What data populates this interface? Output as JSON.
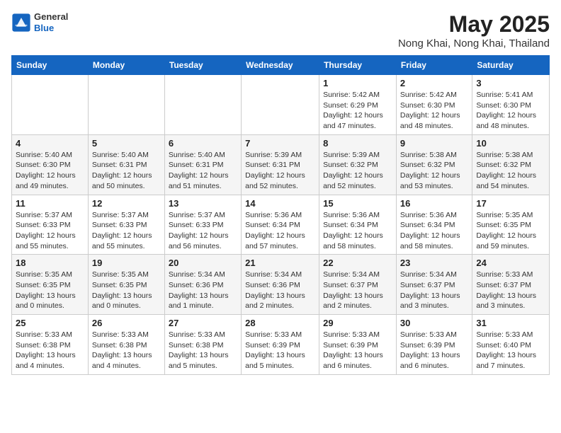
{
  "header": {
    "logo": {
      "general": "General",
      "blue": "Blue"
    },
    "title": "May 2025",
    "location": "Nong Khai, Nong Khai, Thailand"
  },
  "weekdays": [
    "Sunday",
    "Monday",
    "Tuesday",
    "Wednesday",
    "Thursday",
    "Friday",
    "Saturday"
  ],
  "weeks": [
    [
      {
        "day": "",
        "info": ""
      },
      {
        "day": "",
        "info": ""
      },
      {
        "day": "",
        "info": ""
      },
      {
        "day": "",
        "info": ""
      },
      {
        "day": "1",
        "info": "Sunrise: 5:42 AM\nSunset: 6:29 PM\nDaylight: 12 hours\nand 47 minutes."
      },
      {
        "day": "2",
        "info": "Sunrise: 5:42 AM\nSunset: 6:30 PM\nDaylight: 12 hours\nand 48 minutes."
      },
      {
        "day": "3",
        "info": "Sunrise: 5:41 AM\nSunset: 6:30 PM\nDaylight: 12 hours\nand 48 minutes."
      }
    ],
    [
      {
        "day": "4",
        "info": "Sunrise: 5:40 AM\nSunset: 6:30 PM\nDaylight: 12 hours\nand 49 minutes."
      },
      {
        "day": "5",
        "info": "Sunrise: 5:40 AM\nSunset: 6:31 PM\nDaylight: 12 hours\nand 50 minutes."
      },
      {
        "day": "6",
        "info": "Sunrise: 5:40 AM\nSunset: 6:31 PM\nDaylight: 12 hours\nand 51 minutes."
      },
      {
        "day": "7",
        "info": "Sunrise: 5:39 AM\nSunset: 6:31 PM\nDaylight: 12 hours\nand 52 minutes."
      },
      {
        "day": "8",
        "info": "Sunrise: 5:39 AM\nSunset: 6:32 PM\nDaylight: 12 hours\nand 52 minutes."
      },
      {
        "day": "9",
        "info": "Sunrise: 5:38 AM\nSunset: 6:32 PM\nDaylight: 12 hours\nand 53 minutes."
      },
      {
        "day": "10",
        "info": "Sunrise: 5:38 AM\nSunset: 6:32 PM\nDaylight: 12 hours\nand 54 minutes."
      }
    ],
    [
      {
        "day": "11",
        "info": "Sunrise: 5:37 AM\nSunset: 6:33 PM\nDaylight: 12 hours\nand 55 minutes."
      },
      {
        "day": "12",
        "info": "Sunrise: 5:37 AM\nSunset: 6:33 PM\nDaylight: 12 hours\nand 55 minutes."
      },
      {
        "day": "13",
        "info": "Sunrise: 5:37 AM\nSunset: 6:33 PM\nDaylight: 12 hours\nand 56 minutes."
      },
      {
        "day": "14",
        "info": "Sunrise: 5:36 AM\nSunset: 6:34 PM\nDaylight: 12 hours\nand 57 minutes."
      },
      {
        "day": "15",
        "info": "Sunrise: 5:36 AM\nSunset: 6:34 PM\nDaylight: 12 hours\nand 58 minutes."
      },
      {
        "day": "16",
        "info": "Sunrise: 5:36 AM\nSunset: 6:34 PM\nDaylight: 12 hours\nand 58 minutes."
      },
      {
        "day": "17",
        "info": "Sunrise: 5:35 AM\nSunset: 6:35 PM\nDaylight: 12 hours\nand 59 minutes."
      }
    ],
    [
      {
        "day": "18",
        "info": "Sunrise: 5:35 AM\nSunset: 6:35 PM\nDaylight: 13 hours\nand 0 minutes."
      },
      {
        "day": "19",
        "info": "Sunrise: 5:35 AM\nSunset: 6:35 PM\nDaylight: 13 hours\nand 0 minutes."
      },
      {
        "day": "20",
        "info": "Sunrise: 5:34 AM\nSunset: 6:36 PM\nDaylight: 13 hours\nand 1 minute."
      },
      {
        "day": "21",
        "info": "Sunrise: 5:34 AM\nSunset: 6:36 PM\nDaylight: 13 hours\nand 2 minutes."
      },
      {
        "day": "22",
        "info": "Sunrise: 5:34 AM\nSunset: 6:37 PM\nDaylight: 13 hours\nand 2 minutes."
      },
      {
        "day": "23",
        "info": "Sunrise: 5:34 AM\nSunset: 6:37 PM\nDaylight: 13 hours\nand 3 minutes."
      },
      {
        "day": "24",
        "info": "Sunrise: 5:33 AM\nSunset: 6:37 PM\nDaylight: 13 hours\nand 3 minutes."
      }
    ],
    [
      {
        "day": "25",
        "info": "Sunrise: 5:33 AM\nSunset: 6:38 PM\nDaylight: 13 hours\nand 4 minutes."
      },
      {
        "day": "26",
        "info": "Sunrise: 5:33 AM\nSunset: 6:38 PM\nDaylight: 13 hours\nand 4 minutes."
      },
      {
        "day": "27",
        "info": "Sunrise: 5:33 AM\nSunset: 6:38 PM\nDaylight: 13 hours\nand 5 minutes."
      },
      {
        "day": "28",
        "info": "Sunrise: 5:33 AM\nSunset: 6:39 PM\nDaylight: 13 hours\nand 5 minutes."
      },
      {
        "day": "29",
        "info": "Sunrise: 5:33 AM\nSunset: 6:39 PM\nDaylight: 13 hours\nand 6 minutes."
      },
      {
        "day": "30",
        "info": "Sunrise: 5:33 AM\nSunset: 6:39 PM\nDaylight: 13 hours\nand 6 minutes."
      },
      {
        "day": "31",
        "info": "Sunrise: 5:33 AM\nSunset: 6:40 PM\nDaylight: 13 hours\nand 7 minutes."
      }
    ]
  ]
}
